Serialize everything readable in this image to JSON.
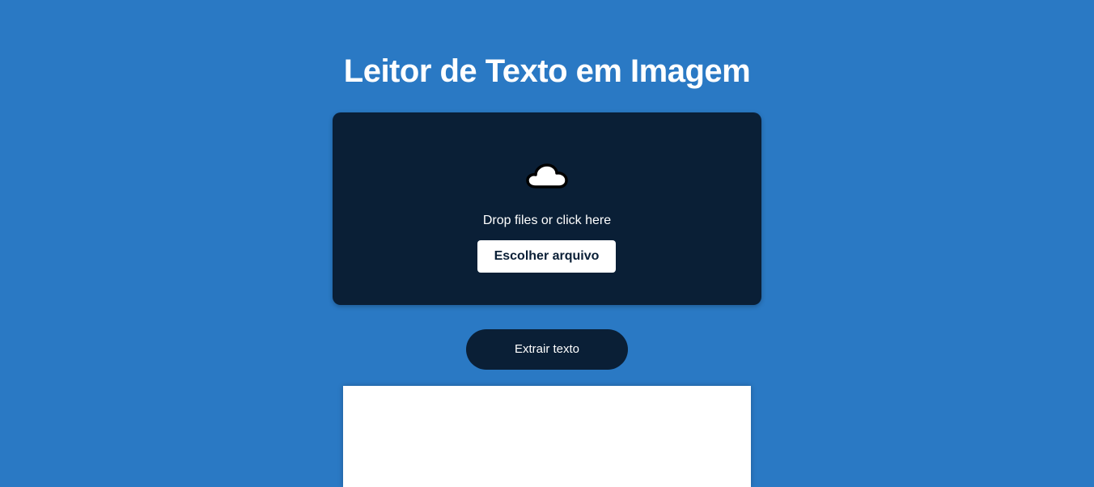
{
  "page": {
    "title": "Leitor de Texto em Imagem",
    "background_color": "#2a79c4"
  },
  "dropzone": {
    "icon": "cloud-upload-icon",
    "instruction": "Drop files or click here",
    "choose_button_label": "Escolher arquivo",
    "background_color": "#0a1f36"
  },
  "actions": {
    "extract_label": "Extrair texto"
  },
  "output": {
    "text": ""
  }
}
